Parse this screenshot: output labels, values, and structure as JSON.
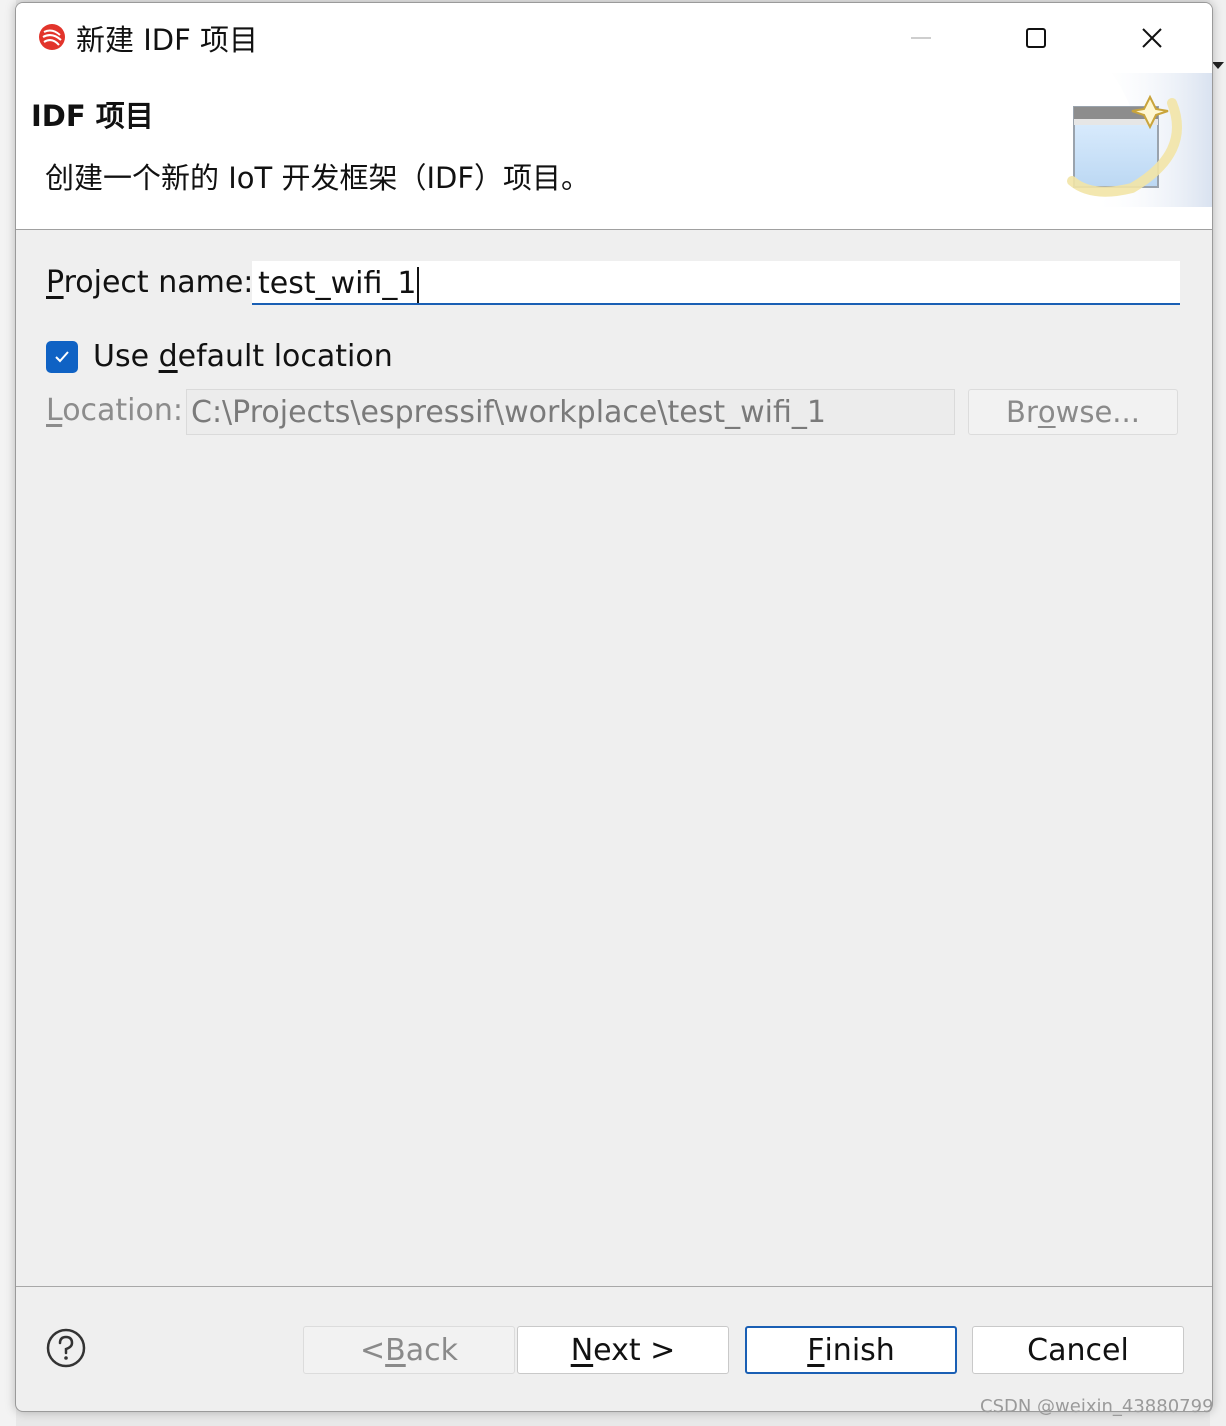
{
  "window": {
    "title": "新建 IDF 项目",
    "controls": {
      "minimize_icon": "minimize-icon",
      "maximize_icon": "maximize-icon",
      "close_icon": "close-icon"
    }
  },
  "banner": {
    "title": "IDF 项目",
    "description": "创建一个新的 IoT 开发框架（IDF）项目。"
  },
  "form": {
    "project_name": {
      "label_mnemonic": "P",
      "label_rest": "roject name:",
      "value": "test_wifi_1"
    },
    "use_default_location": {
      "label_before": "Use ",
      "label_mnemonic": "d",
      "label_after": "efault location",
      "checked": true
    },
    "location": {
      "label_mnemonic": "L",
      "label_rest": "ocation:",
      "value": "C:\\Projects\\espressif\\workplace\\test_wifi_1",
      "enabled": false
    },
    "browse": {
      "label_before": "Br",
      "label_mnemonic": "o",
      "label_after": "wse...",
      "enabled": false
    }
  },
  "footer": {
    "help_icon": "help-icon",
    "back": {
      "prefix": "< ",
      "mnemonic": "B",
      "rest": "ack",
      "enabled": false
    },
    "next": {
      "mnemonic": "N",
      "rest": "ext >"
    },
    "finish": {
      "mnemonic": "F",
      "rest": "inish",
      "default": true
    },
    "cancel": {
      "label": "Cancel"
    }
  },
  "watermark": "CSDN @weixin_43880799",
  "colors": {
    "accent": "#1a5fb4",
    "checkbox": "#0f62c4",
    "app_icon": "#e2342b"
  }
}
